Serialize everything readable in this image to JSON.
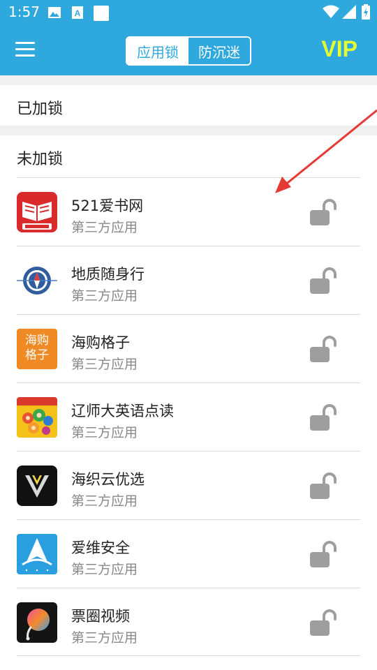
{
  "status_bar": {
    "time": "1:57",
    "icons": [
      "image-icon",
      "a-icon",
      "square-icon",
      "wifi-icon",
      "signal-icon",
      "battery-icon"
    ]
  },
  "app_bar": {
    "menu_icon": "hamburger-menu-icon",
    "tabs": [
      {
        "label": "应用锁",
        "active": true
      },
      {
        "label": "防沉迷",
        "active": false
      }
    ],
    "vip_label": "VIP"
  },
  "sections": {
    "locked_title": "已加锁",
    "unlocked_title": "未加锁"
  },
  "apps": [
    {
      "name": "521爱书网",
      "type": "第三方应用",
      "icon": "book-app-icon"
    },
    {
      "name": "地质随身行",
      "type": "第三方应用",
      "icon": "compass-app-icon"
    },
    {
      "name": "海购格子",
      "type": "第三方应用",
      "icon": "haigou-app-icon",
      "icon_text": [
        "海购",
        "格子"
      ]
    },
    {
      "name": "辽师大英语点读",
      "type": "第三方应用",
      "icon": "english-reading-app-icon"
    },
    {
      "name": "海织云优选",
      "type": "第三方应用",
      "icon": "v-logo-app-icon"
    },
    {
      "name": "爱维安全",
      "type": "第三方应用",
      "icon": "aiwei-app-icon"
    },
    {
      "name": "票圈视频",
      "type": "第三方应用",
      "icon": "piaoquan-app-icon"
    }
  ],
  "colors": {
    "primary": "#2fa8de",
    "vip": "#e6ff33",
    "lock_icon": "#9e9e9e",
    "annotation_arrow": "#e53935"
  }
}
